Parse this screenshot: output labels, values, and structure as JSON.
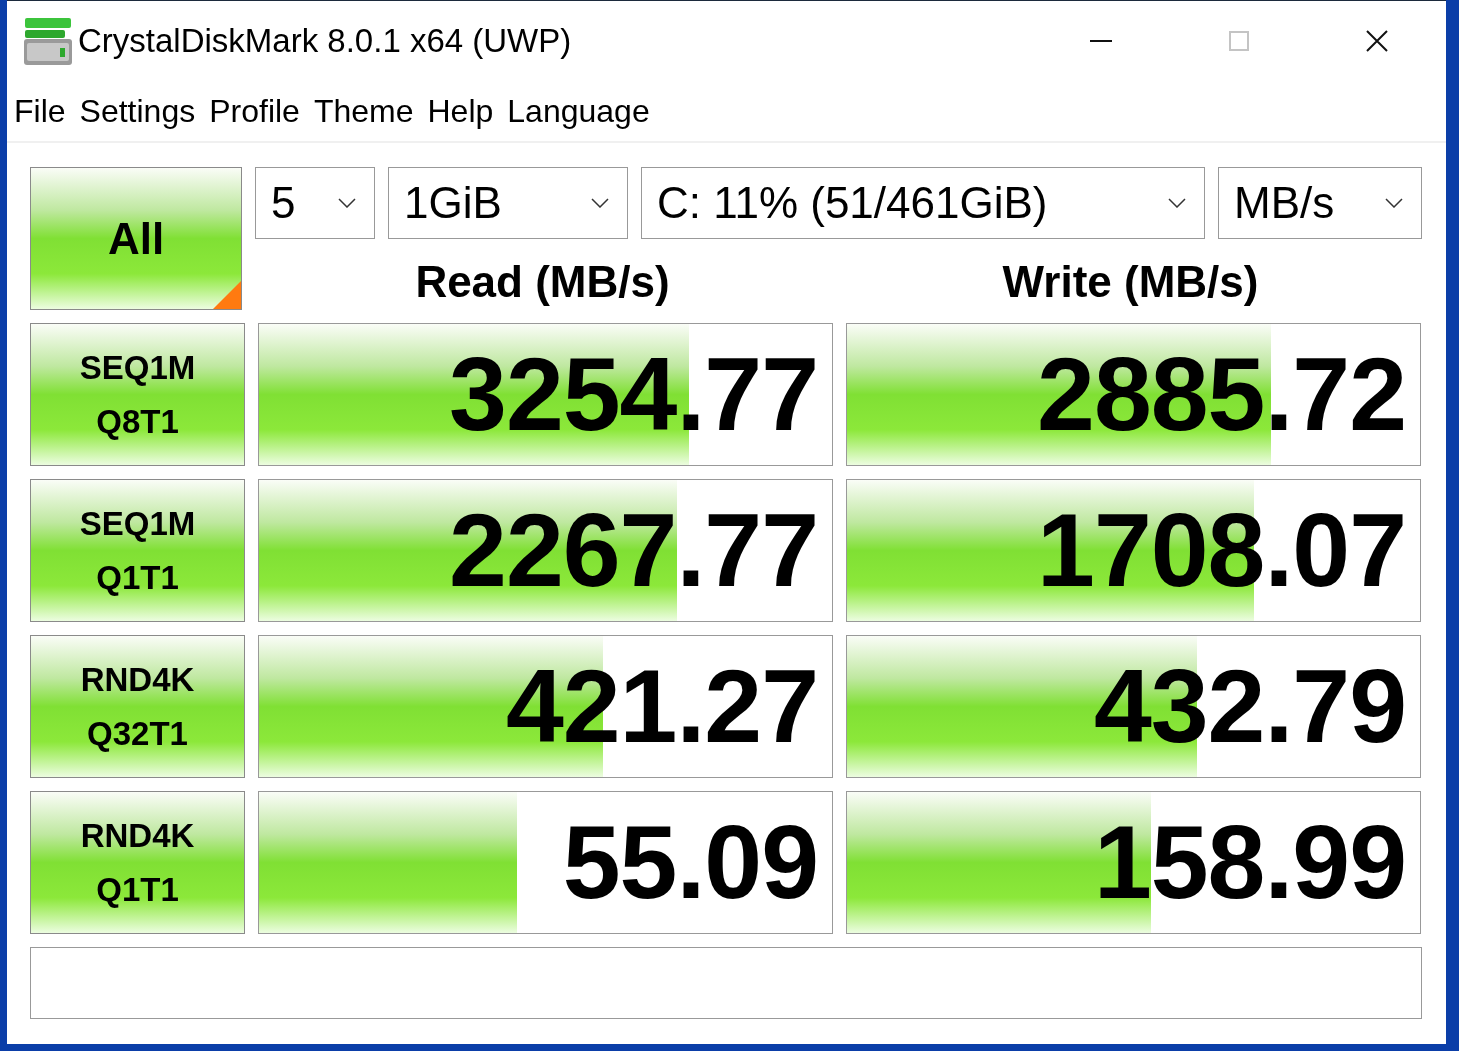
{
  "window": {
    "title": "CrystalDiskMark 8.0.1 x64 (UWP)",
    "controls": [
      {
        "kind": "minimize",
        "disabled": false
      },
      {
        "kind": "maximize",
        "disabled": true
      },
      {
        "kind": "close",
        "disabled": false
      }
    ]
  },
  "menu": [
    "File",
    "Settings",
    "Profile",
    "Theme",
    "Help",
    "Language"
  ],
  "all_button": {
    "label": "All"
  },
  "selects": [
    {
      "value": "5"
    },
    {
      "value": "1GiB"
    },
    {
      "value": "C: 11% (51/461GiB)"
    },
    {
      "value": "MB/s"
    }
  ],
  "headers": [
    "Read (MB/s)",
    "Write (MB/s)"
  ],
  "rows": [
    {
      "label": [
        "SEQ1M",
        "Q8T1"
      ],
      "read": {
        "value": "3254.77",
        "level": 0.75
      },
      "write": {
        "value": "2885.72",
        "level": 0.74
      }
    },
    {
      "label": [
        "SEQ1M",
        "Q1T1"
      ],
      "read": {
        "value": "2267.77",
        "level": 0.73
      },
      "write": {
        "value": "1708.07",
        "level": 0.71
      }
    },
    {
      "label": [
        "RND4K",
        "Q32T1"
      ],
      "read": {
        "value": "421.27",
        "level": 0.6
      },
      "write": {
        "value": "432.79",
        "level": 0.61
      }
    },
    {
      "label": [
        "RND4K",
        "Q1T1"
      ],
      "read": {
        "value": "55.09",
        "level": 0.45
      },
      "write": {
        "value": "158.99",
        "level": 0.53
      }
    }
  ]
}
